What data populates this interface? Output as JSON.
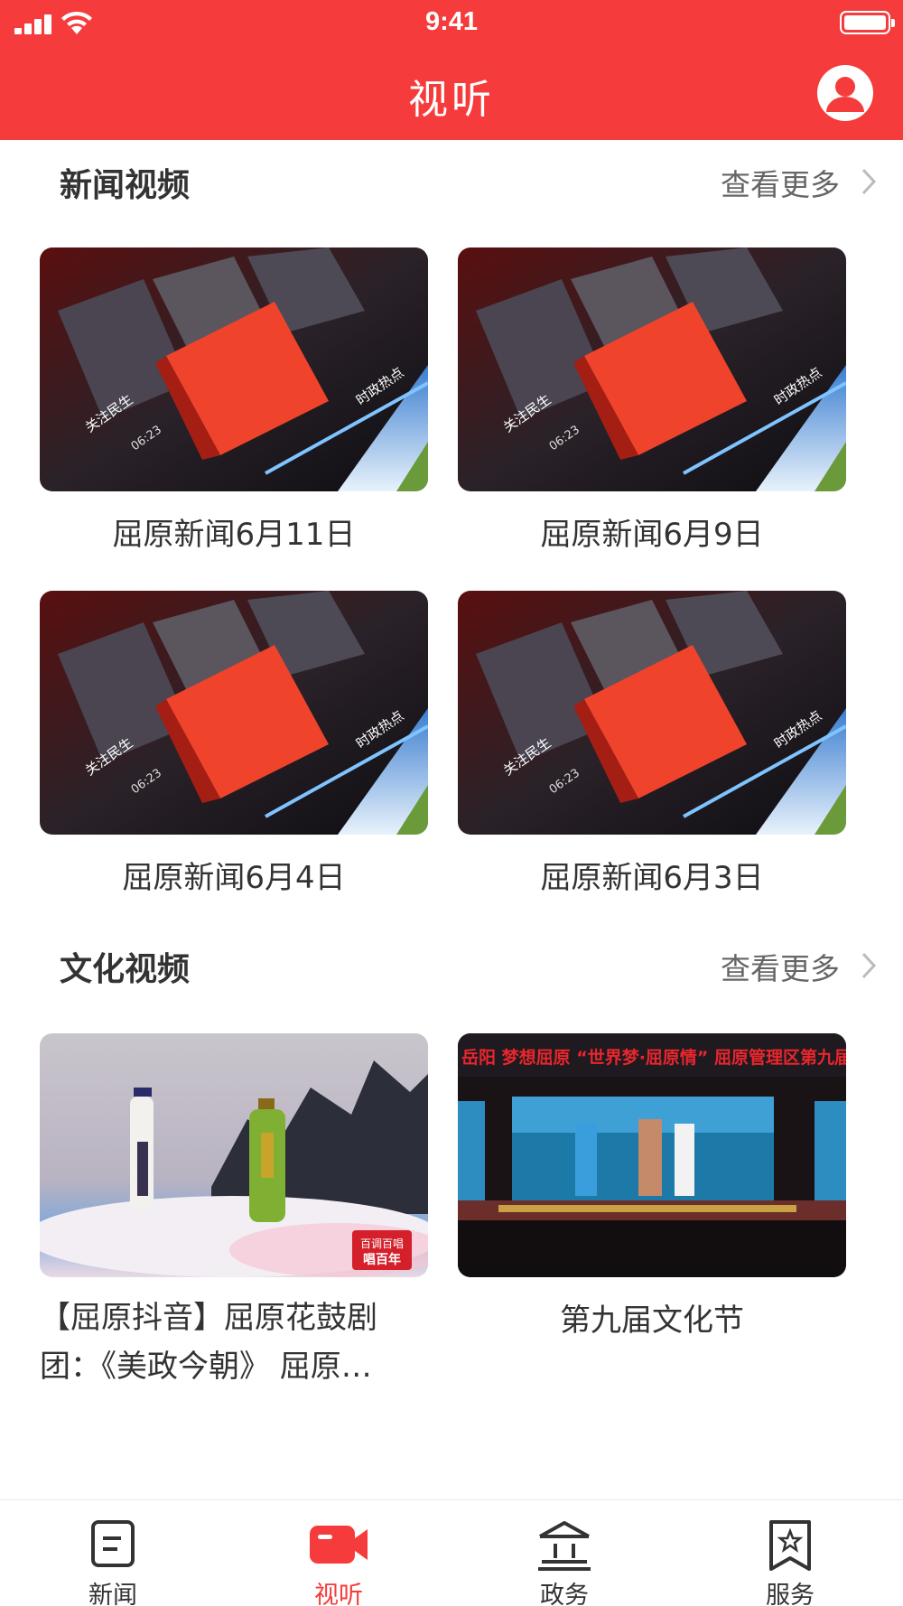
{
  "status_bar": {
    "time": "9:41"
  },
  "header": {
    "title": "视听",
    "profile_icon": "user-avatar-icon"
  },
  "sections": [
    {
      "title": "新闻视频",
      "more_label": "查看更多",
      "items": [
        {
          "caption": "屈原新闻6月11日",
          "thumb_texts": [
            "关注民生",
            "06:23",
            "时政热点"
          ]
        },
        {
          "caption": "屈原新闻6月9日",
          "thumb_texts": [
            "关注民生",
            "06:23",
            "时政热点"
          ]
        },
        {
          "caption": "屈原新闻6月4日",
          "thumb_texts": [
            "关注民生",
            "06:23",
            "时政热点"
          ]
        },
        {
          "caption": "屈原新闻6月3日",
          "thumb_texts": [
            "关注民生",
            "06:23",
            "时政热点"
          ]
        }
      ]
    },
    {
      "title": "文化视频",
      "more_label": "查看更多",
      "items": [
        {
          "caption_line1": "【屈原抖音】屈原花鼓剧",
          "caption_line2": "团：《美政今朝》 屈原…",
          "thumb_badge_line1": "百调百唱",
          "thumb_badge_line2": "唱百年"
        },
        {
          "caption": "第九届文化节",
          "thumb_banner": "岳阳 梦想屈原 “世界梦·屈原情” 屈原管理区第九届文"
        }
      ]
    }
  ],
  "tabbar": {
    "items": [
      {
        "label": "新闻",
        "icon": "news-icon"
      },
      {
        "label": "视听",
        "icon": "video-camera-icon"
      },
      {
        "label": "政务",
        "icon": "government-building-icon"
      },
      {
        "label": "服务",
        "icon": "service-bookmark-icon"
      }
    ],
    "active_index": 1
  },
  "colors": {
    "brand_red": "#f53b3b",
    "text_dark": "#333333",
    "text_grey": "#666666"
  }
}
